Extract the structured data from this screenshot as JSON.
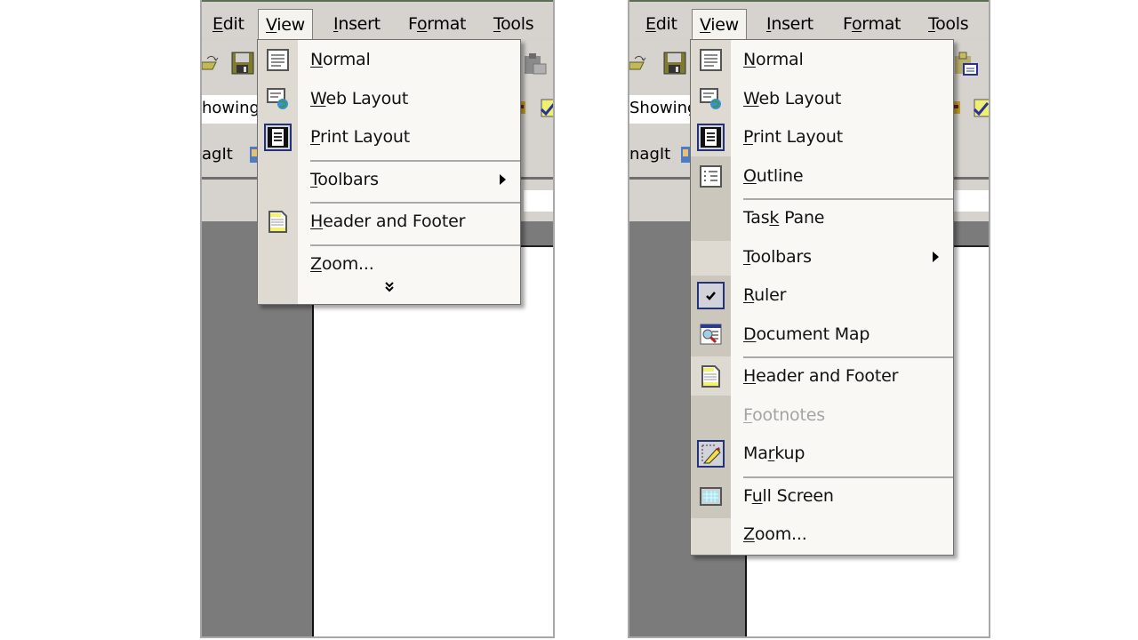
{
  "panels": [
    {
      "id": "collapsed",
      "menubar": [
        {
          "label": "Edit",
          "accel": "E",
          "open": false
        },
        {
          "label": "View",
          "accel": "V",
          "open": true
        },
        {
          "label": "Insert",
          "accel": "I",
          "open": false
        },
        {
          "label": "Format",
          "accel": "o",
          "open": false
        },
        {
          "label": "Tools",
          "accel": "T",
          "open": false
        }
      ],
      "toolbar_text": {
        "input_value": "howing",
        "snagit": "agIt"
      },
      "menu": {
        "items": [
          {
            "type": "item",
            "label": "Normal",
            "accel_index": 0,
            "icon": "normal-view-icon",
            "checked": false
          },
          {
            "type": "item",
            "label": "Web Layout",
            "accel_index": 0,
            "icon": "web-layout-icon",
            "checked": false
          },
          {
            "type": "item",
            "label": "Print Layout",
            "accel_index": 0,
            "icon": "print-layout-icon",
            "checked": true
          },
          {
            "type": "separator"
          },
          {
            "type": "item",
            "label": "Toolbars",
            "accel_index": 0,
            "icon": null,
            "submenu": true
          },
          {
            "type": "separator"
          },
          {
            "type": "item",
            "label": "Header and Footer",
            "accel_index": 0,
            "icon": "header-footer-icon",
            "checked": false
          },
          {
            "type": "separator"
          },
          {
            "type": "item",
            "label": "Zoom...",
            "accel_index": 0,
            "icon": null
          }
        ],
        "expand_glyph": "»"
      }
    },
    {
      "id": "expanded",
      "menubar": [
        {
          "label": "Edit",
          "accel": "E",
          "open": false
        },
        {
          "label": "View",
          "accel": "V",
          "open": true
        },
        {
          "label": "Insert",
          "accel": "I",
          "open": false
        },
        {
          "label": "Format",
          "accel": "o",
          "open": false
        },
        {
          "label": "Tools",
          "accel": "T",
          "open": false
        }
      ],
      "toolbar_text": {
        "input_value": "Showing",
        "snagit": "nagIt"
      },
      "menu": {
        "items": [
          {
            "type": "item",
            "label": "Normal",
            "accel_index": 0,
            "icon": "normal-view-icon",
            "checked": false,
            "hidden_item": false
          },
          {
            "type": "item",
            "label": "Web Layout",
            "accel_index": 0,
            "icon": "web-layout-icon",
            "checked": false,
            "hidden_item": false
          },
          {
            "type": "item",
            "label": "Print Layout",
            "accel_index": 0,
            "icon": "print-layout-icon",
            "checked": true,
            "hidden_item": false
          },
          {
            "type": "item",
            "label": "Outline",
            "accel_index": 0,
            "icon": "outline-view-icon",
            "checked": false,
            "hidden_item": true
          },
          {
            "type": "separator"
          },
          {
            "type": "item",
            "label": "Task Pane",
            "accel_index": 3,
            "icon": null,
            "hidden_item": true
          },
          {
            "type": "item",
            "label": "Toolbars",
            "accel_index": 0,
            "icon": null,
            "submenu": true,
            "hidden_item": false
          },
          {
            "type": "item",
            "label": "Ruler",
            "accel_index": 0,
            "icon": "checkmark-icon",
            "checked": true,
            "hidden_item": true
          },
          {
            "type": "item",
            "label": "Document Map",
            "accel_index": 0,
            "icon": "document-map-icon",
            "checked": false,
            "hidden_item": true
          },
          {
            "type": "separator"
          },
          {
            "type": "item",
            "label": "Header and Footer",
            "accel_index": 0,
            "icon": "header-footer-icon",
            "checked": false,
            "hidden_item": false
          },
          {
            "type": "item",
            "label": "Footnotes",
            "accel_index": 0,
            "icon": null,
            "disabled": true,
            "hidden_item": true
          },
          {
            "type": "item",
            "label": "Markup",
            "accel_index": 2,
            "icon": "markup-icon",
            "checked": true,
            "hidden_item": true
          },
          {
            "type": "separator"
          },
          {
            "type": "item",
            "label": "Full Screen",
            "accel_index": 1,
            "icon": "full-screen-icon",
            "checked": false,
            "hidden_item": true
          },
          {
            "type": "item",
            "label": "Zoom...",
            "accel_index": 0,
            "icon": null,
            "hidden_item": false
          }
        ]
      }
    }
  ],
  "colors": {
    "menu_bg": "#f9f8f4",
    "gutter": "#dedad2",
    "gutter_rare": "#cbc7bd",
    "check_border": "#23337a",
    "toolbar_bg": "#d6d3ce",
    "workspace_gray": "#7b7b7b",
    "disabled_text": "#a4a4a4"
  }
}
